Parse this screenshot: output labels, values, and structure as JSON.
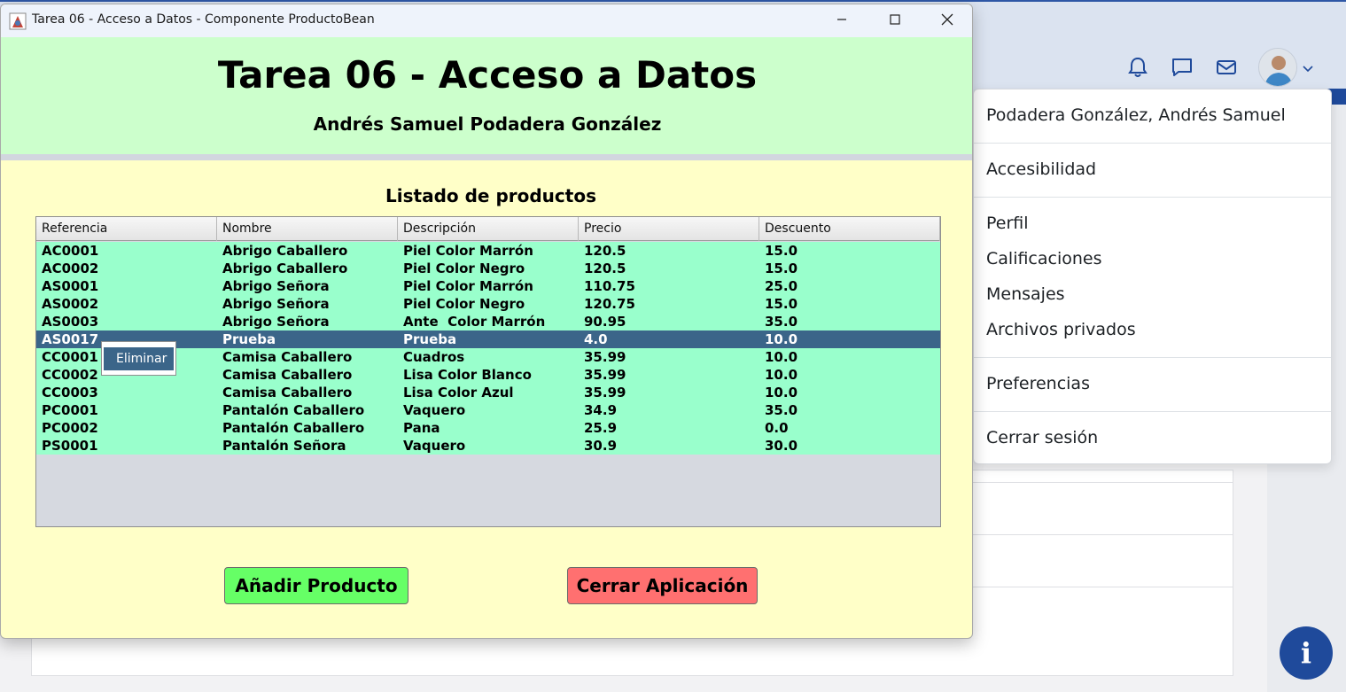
{
  "window": {
    "title": "Tarea 06 - Acceso a Datos - Componente ProductoBean",
    "app_title": "Tarea 06 - Acceso a Datos",
    "author": "Andrés Samuel Podadera González",
    "list_title": "Listado de productos"
  },
  "table": {
    "columns": [
      "Referencia",
      "Nombre",
      "Descripción",
      "Precio",
      "Descuento"
    ],
    "rows": [
      [
        "AC0001",
        "Abrigo Caballero",
        "Piel Color Marrón",
        "120.5",
        "15.0"
      ],
      [
        "AC0002",
        "Abrigo Caballero",
        "Piel Color Negro",
        "120.5",
        "15.0"
      ],
      [
        "AS0001",
        "Abrigo Señora",
        "Piel Color Marrón",
        "110.75",
        "25.0"
      ],
      [
        "AS0002",
        "Abrigo Señora",
        "Piel Color Negro",
        "120.75",
        "15.0"
      ],
      [
        "AS0003",
        "Abrigo Señora",
        "Ante  Color Marrón",
        "90.95",
        "35.0"
      ],
      [
        "AS0017",
        "Prueba",
        "Prueba",
        "4.0",
        "10.0"
      ],
      [
        "CC0001",
        "Camisa Caballero",
        "Cuadros",
        "35.99",
        "10.0"
      ],
      [
        "CC0002",
        "Camisa Caballero",
        "Lisa Color Blanco",
        "35.99",
        "10.0"
      ],
      [
        "CC0003",
        "Camisa Caballero",
        "Lisa Color Azul",
        "35.99",
        "10.0"
      ],
      [
        "PC0001",
        "Pantalón Caballero",
        "Vaquero",
        "34.9",
        "35.0"
      ],
      [
        "PC0002",
        "Pantalón Caballero",
        "Pana",
        "25.9",
        "0.0"
      ],
      [
        "PS0001",
        "Pantalón Señora",
        "Vaquero",
        "30.9",
        "30.0"
      ]
    ],
    "selected_row": 5
  },
  "context_menu": {
    "item": "Eliminar"
  },
  "buttons": {
    "add": "Añadir Producto",
    "close": "Cerrar Aplicación"
  },
  "dropdown": {
    "user_name": "Podadera González, Andrés Samuel",
    "accessibility": "Accesibilidad",
    "profile": "Perfil",
    "grades": "Calificaciones",
    "messages": "Mensajes",
    "private_files": "Archivos privados",
    "preferences": "Preferencias",
    "logout": "Cerrar sesión"
  },
  "info_button": {
    "label": "i"
  },
  "colors": {
    "header_green": "#ccffcc",
    "body_yellow": "#ffffc8",
    "row_green": "#99ffcc",
    "selected_row": "#3b6589",
    "add_button": "#66ff66",
    "close_button": "#ff7070",
    "brand_blue": "#1f4a9b"
  },
  "icons": [
    "notification-bell-icon",
    "chat-icon",
    "mail-icon",
    "chevron-down-icon",
    "java-app-icon",
    "minimize-icon",
    "maximize-icon",
    "close-icon",
    "info-icon"
  ]
}
